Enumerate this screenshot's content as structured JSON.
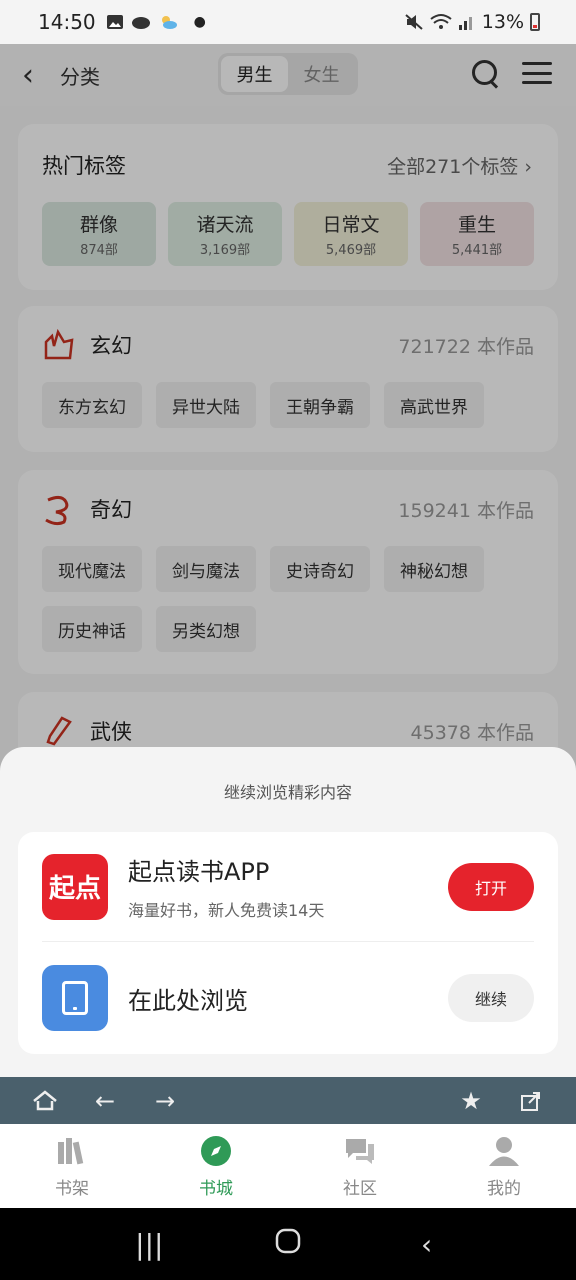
{
  "status": {
    "time": "14:50",
    "battery": "13%"
  },
  "nav": {
    "title": "分类",
    "seg": [
      "男生",
      "女生"
    ],
    "seg_active": 0
  },
  "hot": {
    "title": "热门标签",
    "all": "全部271个标签 ›",
    "tags": [
      {
        "name": "群像",
        "count": "874部",
        "color": "#dbe9e1"
      },
      {
        "name": "诸天流",
        "count": "3,169部",
        "color": "#e0efe4"
      },
      {
        "name": "日常文",
        "count": "5,469部",
        "color": "#f3f1da"
      },
      {
        "name": "重生",
        "count": "5,441部",
        "color": "#f3e2e4"
      }
    ]
  },
  "categories": [
    {
      "name": "玄幻",
      "count": "721722 本作品",
      "chips": [
        "东方玄幻",
        "异世大陆",
        "王朝争霸",
        "高武世界"
      ]
    },
    {
      "name": "奇幻",
      "count": "159241 本作品",
      "chips": [
        "现代魔法",
        "剑与魔法",
        "史诗奇幻",
        "神秘幻想",
        "历史神话",
        "另类幻想"
      ]
    },
    {
      "name": "武侠",
      "count": "45378 本作品",
      "chips": []
    }
  ],
  "sheet": {
    "caption": "继续浏览精彩内容",
    "app": {
      "icon_text": "起点",
      "title": "起点读书APP",
      "subtitle": "海量好书，新人免费读14天",
      "button": "打开"
    },
    "browser": {
      "title": "在此处浏览",
      "button": "继续"
    }
  },
  "toolbar": [
    "home-icon",
    "back-arrow-icon",
    "forward-arrow-icon",
    "star-icon",
    "share-icon"
  ],
  "tabs": [
    {
      "label": "书架",
      "icon": "bookshelf-icon"
    },
    {
      "label": "书城",
      "icon": "compass-icon",
      "active": true
    },
    {
      "label": "社区",
      "icon": "chat-icon"
    },
    {
      "label": "我的",
      "icon": "user-icon"
    }
  ],
  "colors": {
    "accent_red": "#e5232c",
    "accent_green": "#2f9a57",
    "toolbar": "#4a606c"
  }
}
